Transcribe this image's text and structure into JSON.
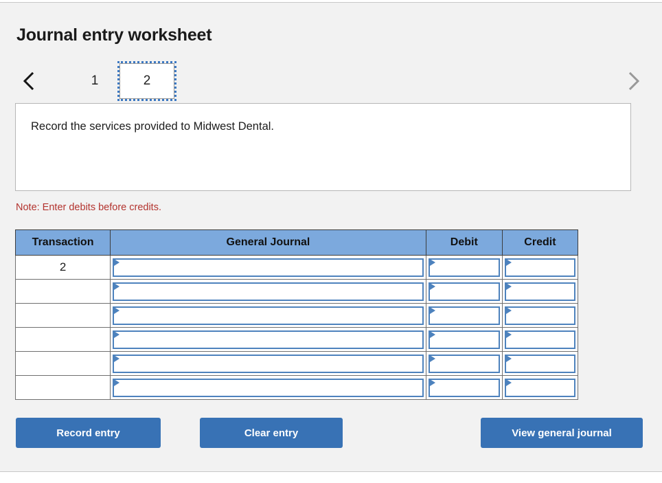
{
  "page": {
    "title": "Journal entry worksheet"
  },
  "pager": {
    "prev_icon": "chevron-left-icon",
    "next_icon": "chevron-right-icon",
    "tabs": [
      {
        "label": "1",
        "active": false
      },
      {
        "label": "2",
        "active": true
      }
    ]
  },
  "instruction": {
    "text": "Record the services provided to Midwest Dental."
  },
  "note": {
    "text": "Note: Enter debits before credits."
  },
  "table": {
    "headers": [
      "Transaction",
      "General Journal",
      "Debit",
      "Credit"
    ],
    "rows": [
      {
        "transaction": "2",
        "general_journal": "",
        "debit": "",
        "credit": ""
      },
      {
        "transaction": "",
        "general_journal": "",
        "debit": "",
        "credit": ""
      },
      {
        "transaction": "",
        "general_journal": "",
        "debit": "",
        "credit": ""
      },
      {
        "transaction": "",
        "general_journal": "",
        "debit": "",
        "credit": ""
      },
      {
        "transaction": "",
        "general_journal": "",
        "debit": "",
        "credit": ""
      },
      {
        "transaction": "",
        "general_journal": "",
        "debit": "",
        "credit": ""
      }
    ]
  },
  "buttons": {
    "record": "Record entry",
    "clear": "Clear entry",
    "view": "View general journal"
  },
  "colors": {
    "panel_background": "#f2f2f2",
    "table_header_blue": "#7ca9dd",
    "button_blue": "#3872b5",
    "note_red": "#b3332e",
    "field_border_blue": "#4d82bd",
    "active_tab_outline": "#3b78c2"
  }
}
